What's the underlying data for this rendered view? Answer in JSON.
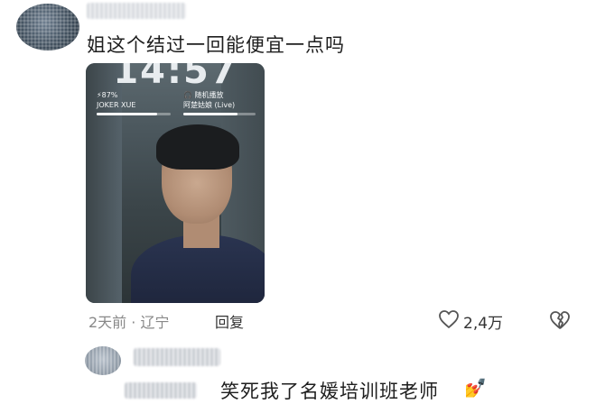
{
  "comment": {
    "text": "姐这个结过一回能便宜一点吗",
    "photo": {
      "clock": "14:57",
      "left_widget": {
        "battery": "⚡87%",
        "name": "JOKER XUE",
        "progress": 0.82
      },
      "right_widget": {
        "app": "🎧 随机播放",
        "song": "阿楚姑娘 (Live)",
        "progress": 0.75
      }
    },
    "time": "2天前",
    "location": "辽宁",
    "separator": "·",
    "reply_label": "回复",
    "likes": "2,4万"
  },
  "reply": {
    "text": "笑死我了名媛培训班老师",
    "emoji": "💅"
  },
  "colors": {
    "meta": "#888888",
    "text": "#1e1e1e",
    "heart": "#555555"
  }
}
